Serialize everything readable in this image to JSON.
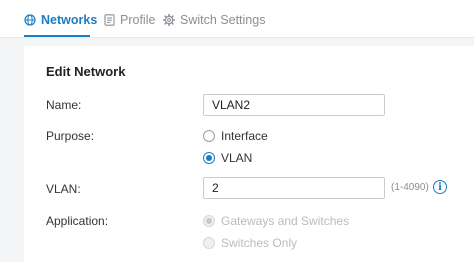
{
  "tabs": [
    {
      "label": "Networks",
      "icon": "globe-icon",
      "active": true
    },
    {
      "label": "Profile",
      "icon": "document-icon",
      "active": false
    },
    {
      "label": "Switch Settings",
      "icon": "gear-icon",
      "active": false
    }
  ],
  "form": {
    "title": "Edit Network",
    "name_label": "Name:",
    "name_value": "VLAN2",
    "purpose_label": "Purpose:",
    "purpose_options": [
      {
        "label": "Interface",
        "selected": false
      },
      {
        "label": "VLAN",
        "selected": true
      }
    ],
    "vlan_label": "VLAN:",
    "vlan_value": "2",
    "vlan_range": "(1-4090)",
    "application_label": "Application:",
    "application_options": [
      {
        "label": "Gateways and Switches",
        "selected": true,
        "disabled": true
      },
      {
        "label": "Switches Only",
        "selected": false,
        "disabled": true
      }
    ]
  },
  "colors": {
    "accent": "#1a7ec2",
    "background": "#f4f5f7",
    "panel": "#ffffff",
    "muted_text": "#8a8f96",
    "disabled_text": "#b7bcc2"
  }
}
